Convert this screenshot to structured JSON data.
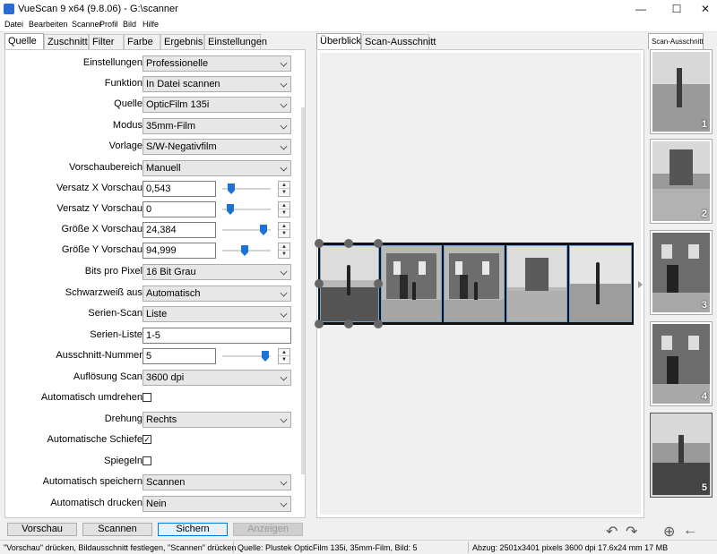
{
  "window": {
    "title": "VueScan 9 x64 (9.8.06) - G:\\scanner",
    "minimize_glyph": "—",
    "maximize_glyph": "☐",
    "close_glyph": "✕"
  },
  "menu": [
    "Datei",
    "Bearbeiten",
    "Scanner",
    "Profil",
    "Bild",
    "Hilfe"
  ],
  "left_tabs": [
    "Quelle",
    "Zuschnitt",
    "Filter",
    "Farbe",
    "Ergebnis",
    "Einstellungen"
  ],
  "form": {
    "einstellungen": {
      "label": "Einstellungen:",
      "value": "Professionelle"
    },
    "funktion": {
      "label": "Funktion:",
      "value": "In Datei scannen"
    },
    "quelle": {
      "label": "Quelle:",
      "value": "OpticFilm 135i"
    },
    "modus": {
      "label": "Modus:",
      "value": "35mm-Film"
    },
    "vorlage": {
      "label": "Vorlage:",
      "value": "S/W-Negativfilm"
    },
    "vorschaubereich": {
      "label": "Vorschaubereich:",
      "value": "Manuell"
    },
    "versatz_x": {
      "label": "Versatz X Vorschau:",
      "value": "0,543",
      "slider_level": 0.12
    },
    "versatz_y": {
      "label": "Versatz Y Vorschau:",
      "value": "0",
      "slider_level": 0.1
    },
    "groesse_x": {
      "label": "Größe X Vorschau:",
      "value": "24,384",
      "slider_level": 0.92
    },
    "groesse_y": {
      "label": "Größe Y Vorschau:",
      "value": "94,999",
      "slider_level": 0.45
    },
    "bits": {
      "label": "Bits pro Pixel:",
      "value": "16 Bit Grau"
    },
    "schwarzweiss": {
      "label": "Schwarzweiß aus:",
      "value": "Automatisch"
    },
    "serien_scan": {
      "label": "Serien-Scan:",
      "value": "Liste"
    },
    "serien_liste": {
      "label": "Serien-Liste:",
      "value": "1-5"
    },
    "ausschnitt": {
      "label": "Ausschnitt-Nummer:",
      "value": "5",
      "slider_level": 0.95
    },
    "aufloesung": {
      "label": "Auflösung Scan:",
      "value": "3600 dpi"
    },
    "umdrehen": {
      "label": "Automatisch umdrehen:",
      "checked": false
    },
    "drehung": {
      "label": "Drehung:",
      "value": "Rechts"
    },
    "schiefe": {
      "label": "Automatische Schiefe:",
      "checked": true
    },
    "spiegeln": {
      "label": "Spiegeln:",
      "checked": false
    },
    "speichern": {
      "label": "Automatisch speichern:",
      "value": "Scannen"
    },
    "drucken": {
      "label": "Automatisch drucken:",
      "value": "Nein"
    }
  },
  "check_glyph": "✓",
  "spinner": {
    "up": "▲",
    "down": "▼"
  },
  "buttons": {
    "vorschau": "Vorschau",
    "scannen": "Scannen",
    "sichern": "Sichern",
    "anzeigen": "Anzeigen"
  },
  "preview_tabs": [
    "Überblick",
    "Scan-Ausschnitt"
  ],
  "side_tab": "Scan-Ausschnitt",
  "thumbnails": [
    "1",
    "2",
    "3",
    "4",
    "5"
  ],
  "tool_icons": {
    "rotate_left": "↶",
    "rotate_right": "↷",
    "zoom": "⊕",
    "back": "←"
  },
  "status": {
    "hint": "\"Vorschau\" drücken, Bildausschnitt festlegen, \"Scannen\" drücken",
    "source": "Quelle: Plustek OpticFilm 135i, 35mm-Film, Bild: 5",
    "output": "Abzug: 2501x3401 pixels 3600 dpi 17.6x24 mm 17 MB"
  },
  "colors": {
    "accent": "#0078d7",
    "slider": "#1c73d6",
    "selection": "#6fa3d8"
  }
}
